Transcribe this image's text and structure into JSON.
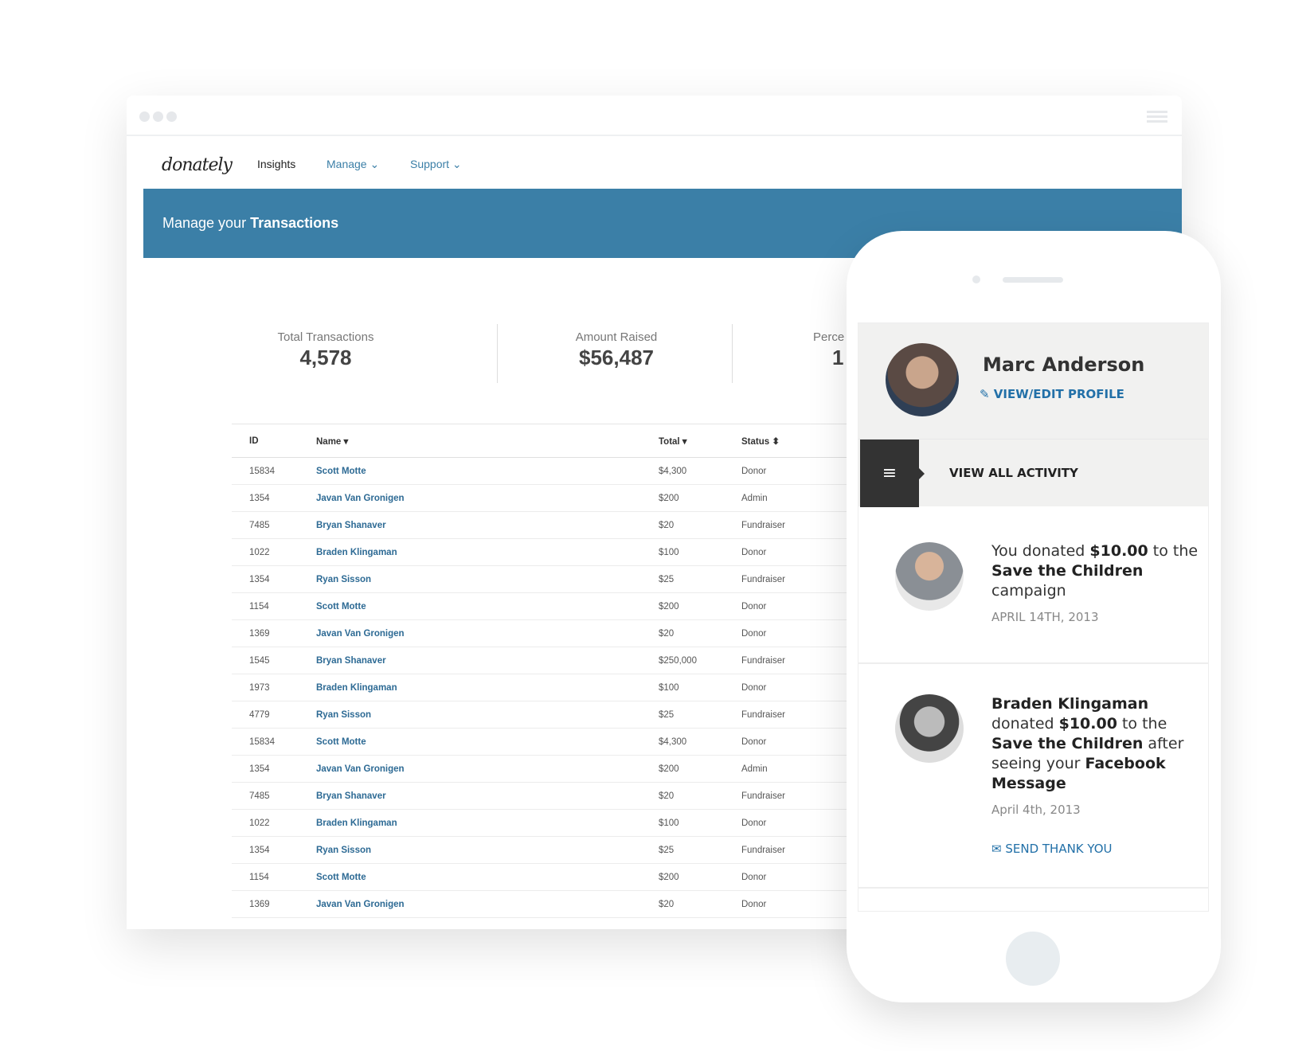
{
  "browser": {
    "logo": "donately",
    "nav": [
      "Insights",
      "Manage ⌄",
      "Support ⌄"
    ]
  },
  "banner": {
    "prefix": "Manage your ",
    "bold": "Transactions"
  },
  "stats": [
    {
      "label": "Total Transactions",
      "value": "4,578"
    },
    {
      "label": "Amount Raised",
      "value": "$56,487"
    },
    {
      "label": "Perce",
      "value": "1"
    }
  ],
  "table": {
    "headers": [
      "ID",
      "Name ▾",
      "Total ▾",
      "Status ⬍"
    ],
    "rows": [
      [
        "15834",
        "Scott Motte",
        "$4,300",
        "Donor"
      ],
      [
        "1354",
        "Javan Van Gronigen",
        "$200",
        "Admin"
      ],
      [
        "7485",
        "Bryan Shanaver",
        "$20",
        "Fundraiser"
      ],
      [
        "1022",
        "Braden Klingaman",
        "$100",
        "Donor"
      ],
      [
        "1354",
        "Ryan Sisson",
        "$25",
        "Fundraiser"
      ],
      [
        "1154",
        "Scott Motte",
        "$200",
        "Donor"
      ],
      [
        "1369",
        "Javan Van Gronigen",
        "$20",
        "Donor"
      ],
      [
        "1545",
        "Bryan Shanaver",
        "$250,000",
        "Fundraiser"
      ],
      [
        "1973",
        "Braden Klingaman",
        "$100",
        "Donor"
      ],
      [
        "4779",
        "Ryan Sisson",
        "$25",
        "Fundraiser"
      ],
      [
        "15834",
        "Scott Motte",
        "$4,300",
        "Donor"
      ],
      [
        "1354",
        "Javan Van Gronigen",
        "$200",
        "Admin"
      ],
      [
        "7485",
        "Bryan Shanaver",
        "$20",
        "Fundraiser"
      ],
      [
        "1022",
        "Braden Klingaman",
        "$100",
        "Donor"
      ],
      [
        "1354",
        "Ryan Sisson",
        "$25",
        "Fundraiser"
      ],
      [
        "1154",
        "Scott Motte",
        "$200",
        "Donor"
      ],
      [
        "1369",
        "Javan Van Gronigen",
        "$20",
        "Donor"
      ]
    ]
  },
  "phone": {
    "name": "Marc Anderson",
    "edit": "VIEW/EDIT PROFILE",
    "activity": "VIEW ALL ACTIVITY",
    "item1": {
      "t1": "You donated ",
      "b1": "$10.00",
      "t2": " to the ",
      "b2": "Save the Children",
      "t3": " campaign",
      "date": "APRIL 14TH, 2013"
    },
    "item2": {
      "b0": "Braden Klingaman",
      "t1": " donated ",
      "b1": "$10.00",
      "t2": " to the ",
      "b2": "Save the Children",
      "t3": " after seeing your ",
      "b3": "Facebook Message",
      "date": "April 4th, 2013",
      "send": "SEND THANK YOU"
    }
  },
  "colors": {
    "brand": "#3b7fa7",
    "link": "#2270a8"
  }
}
